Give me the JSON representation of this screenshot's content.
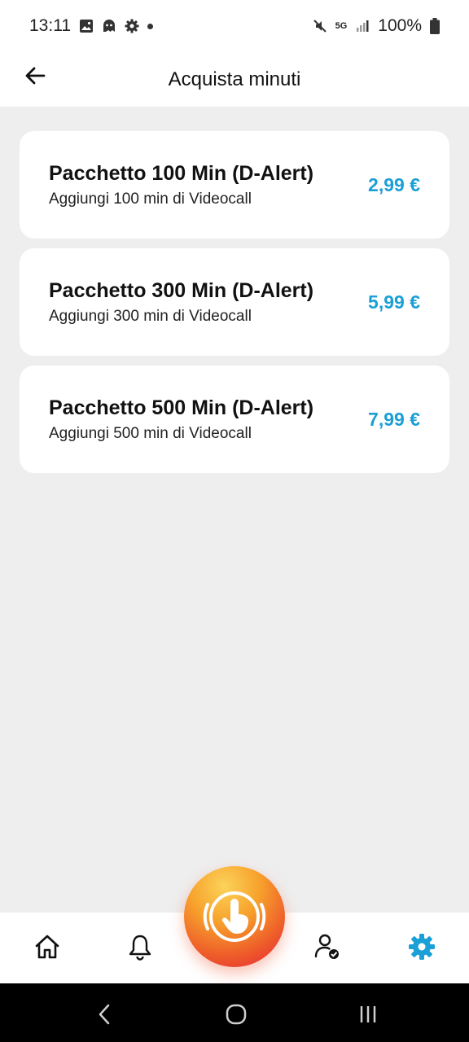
{
  "status_bar": {
    "time": "13:11",
    "battery": "100%",
    "network": "5G",
    "left_icons": [
      "image-icon",
      "ghost-icon",
      "gear-icon",
      "dot-icon"
    ],
    "right_icons": [
      "mute-icon",
      "signal-icon",
      "battery-icon"
    ]
  },
  "app_bar": {
    "title": "Acquista minuti",
    "back_icon": "arrow-left-icon"
  },
  "packages": [
    {
      "title": "Pacchetto 100 Min (D-Alert)",
      "subtitle": "Aggiungi 100 min di Videocall",
      "price": "2,99 €"
    },
    {
      "title": "Pacchetto 300 Min (D-Alert)",
      "subtitle": "Aggiungi 300 min di Videocall",
      "price": "5,99 €"
    },
    {
      "title": "Pacchetto 500 Min (D-Alert)",
      "subtitle": "Aggiungi 500 min di Videocall",
      "price": "7,99 €"
    }
  ],
  "bottom_nav": {
    "items": [
      "home-icon",
      "bell-icon",
      "sos-button",
      "user-check-icon",
      "gear-icon"
    ],
    "active": "gear-icon",
    "active_color": "#1a9fd6"
  },
  "colors": {
    "accent": "#1a9fd6",
    "background": "#eeeeee",
    "sos_gradient": [
      "#fcd35a",
      "#f7a22c",
      "#ee5a2a",
      "#e5213b"
    ]
  },
  "system_nav": [
    "back-chevron-icon",
    "home-circle-icon",
    "recents-icon"
  ]
}
